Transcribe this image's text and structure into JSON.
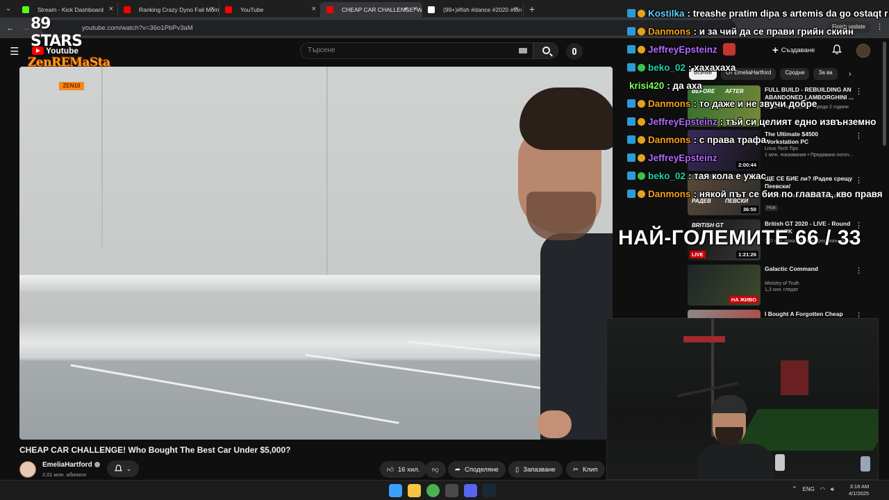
{
  "browser": {
    "tabs": [
      {
        "label": "Stream - Kick Dashboard",
        "favicon_color": "#53fc18",
        "active": false
      },
      {
        "label": "Ranking Crazy Dyno Fail Mome",
        "favicon_color": "#ff0000",
        "active": false
      },
      {
        "label": "YouTube",
        "favicon_color": "#ff0000",
        "active": false
      },
      {
        "label": "CHEAP CAR CHALLENGE! W",
        "favicon_color": "#ff0000",
        "active": true
      },
      {
        "label": "(99+)#fish #dance #2020 #fun",
        "favicon_color": "#ffffff",
        "active": false
      }
    ],
    "url": "youtube.com/watch?v=36o1PbPv3aM",
    "finish_update": "Finish update"
  },
  "youtube": {
    "logo_text": "Youtube",
    "search_placeholder": "Търсене",
    "create_label": "Създаване",
    "video": {
      "title": "CHEAP CAR CHALLENGE! Who Bought The Best Car Under $5,000?",
      "channel": "EmeliaHartford",
      "subscribers": "2,01 млн. абонати",
      "likes": "16 хил.",
      "share_label": "Споделяне",
      "save_label": "Запазване",
      "clip_label": "Клип"
    },
    "chips": [
      "Всички",
      "От EmeliaHartford",
      "Сродни",
      "За ва"
    ],
    "recommendations": [
      {
        "title": "FULL BUILD - REBUILDING AN ABANDONED LAMBORGHINI ...",
        "channel": "",
        "meta": "3,6 млн. показвания • преди 2 години",
        "duration": "",
        "thumb": "#2e6b2d",
        "thumb2": "#7a8a3a",
        "labels": [
          "BEFORE",
          "AFTER"
        ]
      },
      {
        "title": "The Ultimate $4500 Workstation PC",
        "channel": "Linus Tech Tips",
        "meta": "1 млн. показвания • Предавано поточ...",
        "duration": "2:00:44",
        "thumb": "#3a2c5e",
        "thumb2": "#141414",
        "labels": []
      },
      {
        "title": "ЩЕ СЕ БИЕ ли? /Радев срещу Пеевски/",
        "channel": "",
        "meta": "165 хил. показвания • преди 2 дни",
        "duration": "36:50",
        "thumb": "#5a4a3a",
        "thumb2": "#2b2b2b",
        "labels": [
          "РАДЕВ",
          "ПЕВСКИ"
        ],
        "badge": "Нов"
      },
      {
        "title": "British GT 2020 - LIVE - Round 1 ... PARK",
        "channel": "",
        "meta": "190 хил. показвания • Предавано поточ...",
        "duration": "1:21:26",
        "thumb": "#111111",
        "thumb2": "#3a3a3a",
        "labels": [
          "BRITISH GT"
        ],
        "live_tag": "LIVE"
      },
      {
        "title": "Galactic Command",
        "channel": "Ministry of Truth",
        "meta": "1,3 хил. гледат",
        "duration": "",
        "thumb": "#202428",
        "thumb2": "#3c4a2a",
        "labels": [],
        "live": "НА ЖИВО"
      },
      {
        "title": "I Bought A Forgotten Cheap",
        "channel": "",
        "meta": "",
        "duration": "",
        "thumb": "#8a8a8a",
        "thumb2": "#b3413a",
        "labels": []
      }
    ]
  },
  "overlay": {
    "logo_top": "89 STARS",
    "logo_name": "ZenREMaSta",
    "logo_tag": "ZEN10",
    "counter": "НАЙ-ГОЛЕМИТЕ 66 / 33",
    "chat": [
      {
        "user": "Kostilka",
        "color": "#5fd3ff",
        "text": ": treashe pratim dipa s artemis da go ostaqt r"
      },
      {
        "user": "Danmons",
        "color": "#f6a21a",
        "text": ": и за чий да се прави грийн скийн"
      },
      {
        "user": "JeffreyEpsteinz",
        "color": "#b26bff",
        "text": ""
      },
      {
        "user": "beko_02",
        "color": "#1fd3a8",
        "text": ": хахахаха"
      },
      {
        "user": "krisi420",
        "color": "#7cff5a",
        "text": ": да аха"
      },
      {
        "user": "Danmons",
        "color": "#f6a21a",
        "text": ": то даже и не звучи добре"
      },
      {
        "user": "JeffreyEpsteinz",
        "color": "#b26bff",
        "text": ": тъй си целият едно извънземно"
      },
      {
        "user": "Danmons",
        "color": "#f6a21a",
        "text": ": с права трафа"
      },
      {
        "user": "JeffreyEpsteinz",
        "color": "#b26bff",
        "text": ""
      },
      {
        "user": "beko_02",
        "color": "#1fd3a8",
        "text": ": тая кола е ужас"
      },
      {
        "user": "Danmons",
        "color": "#f6a21a",
        "text": ": някой път се бия по главата, кво правя"
      }
    ]
  },
  "taskbar": {
    "apps": [
      {
        "name": "windows-start-icon",
        "color": "#3aa0ff"
      },
      {
        "name": "file-explorer-icon",
        "color": "#f5c542"
      },
      {
        "name": "chrome-icon",
        "color": "#4caf50"
      },
      {
        "name": "obs-icon",
        "color": "#4a4a4a"
      },
      {
        "name": "discord-icon",
        "color": "#5865f2"
      },
      {
        "name": "steam-icon",
        "color": "#1b2838"
      }
    ],
    "lang": "ENG",
    "time": "3:18 AM",
    "date": "4/1/2025"
  }
}
